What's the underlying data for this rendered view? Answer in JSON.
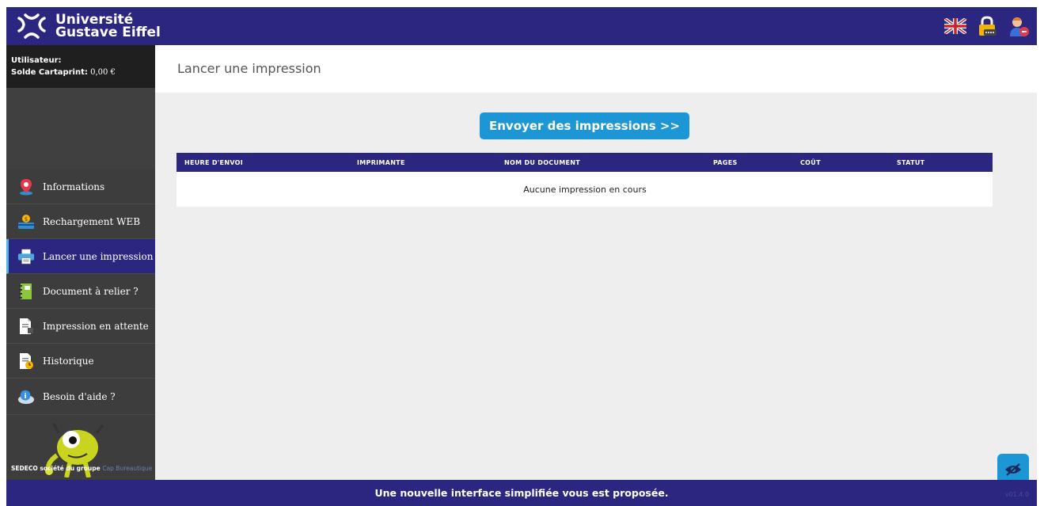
{
  "header": {
    "logo_line1": "Université",
    "logo_line2": "Gustave Eiffel",
    "icons": [
      "uk-flag-icon",
      "lock-icon",
      "user-icon"
    ]
  },
  "sidebar": {
    "user_label": "Utilisateur:",
    "user_value": "",
    "balance_label": "Solde Cartaprint:",
    "balance_value": "0,00 €",
    "items": [
      {
        "label": "Informations",
        "icon": "map-pin-icon",
        "active": false
      },
      {
        "label": "Rechargement WEB",
        "icon": "money-card-icon",
        "active": false
      },
      {
        "label": "Lancer une impression",
        "icon": "printer-icon",
        "active": true
      },
      {
        "label": "Document à relier ?",
        "icon": "notebook-icon",
        "active": false
      },
      {
        "label": "Impression en attente",
        "icon": "pending-document-icon",
        "active": false
      },
      {
        "label": "Historique",
        "icon": "history-document-icon",
        "active": false
      },
      {
        "label": "Besoin d'aide ?",
        "icon": "help-icon",
        "active": false
      }
    ],
    "footer_text": "SEDECO société du groupe",
    "footer_link": "Cap Bureautique"
  },
  "main": {
    "title": "Lancer une impression",
    "send_button": "Envoyer des impressions >>",
    "table": {
      "columns": [
        "HEURE D'ENVOI",
        "IMPRIMANTE",
        "NOM DU DOCUMENT",
        "PAGES",
        "COÛT",
        "STATUT"
      ],
      "empty_message": "Aucune impression en cours"
    }
  },
  "footer": {
    "message": "Une nouvelle interface simplifiée vous est proposée.",
    "version": "v01.4.0"
  },
  "colors": {
    "brand": "#2b2680",
    "accent": "#1d96d6",
    "sidebar": "#3d3d3d"
  }
}
